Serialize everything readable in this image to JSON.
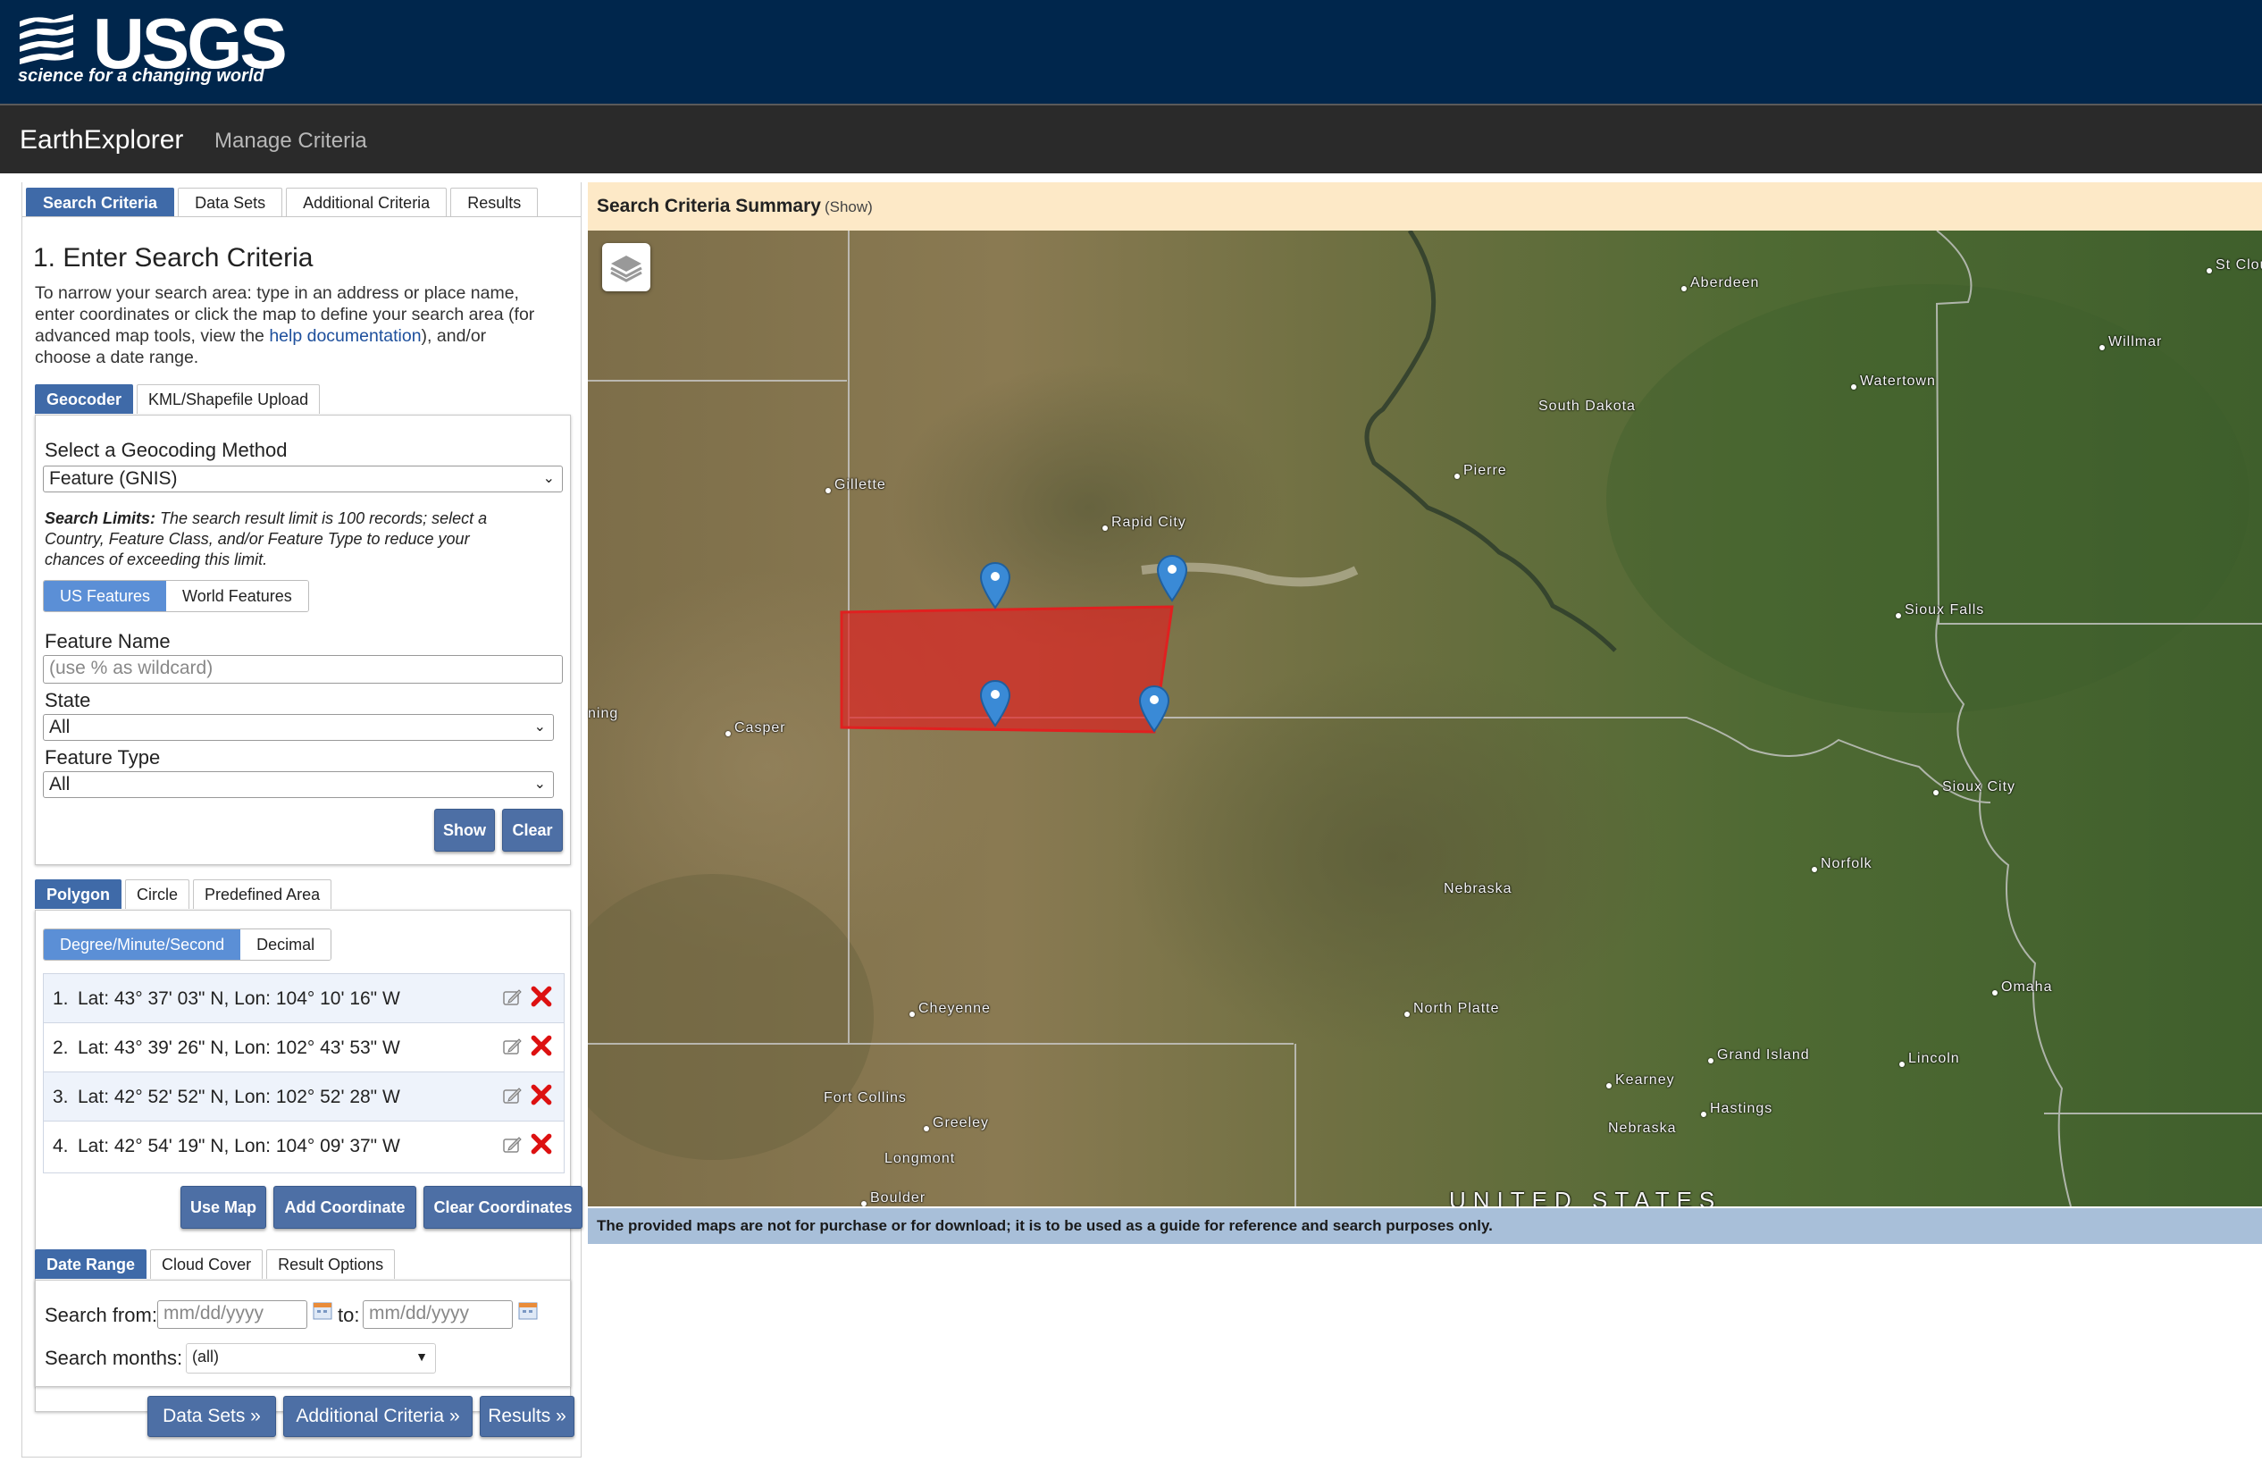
{
  "header": {
    "logo_text": "USGS",
    "tagline": "science for a changing world",
    "app_title": "EarthExplorer",
    "manage_link": "Manage Criteria"
  },
  "main_tabs": [
    "Search Criteria",
    "Data Sets",
    "Additional Criteria",
    "Results"
  ],
  "step": {
    "heading": "1. Enter Search Criteria",
    "intro_1": "To narrow your search area: type in an address or place name,",
    "intro_2": "enter coordinates or click the map to define your search area (for",
    "intro_3a": "advanced map tools, view the ",
    "intro_link": "help documentation",
    "intro_3b": "), and/or",
    "intro_4": "choose a date range."
  },
  "geocoder_tabs": [
    "Geocoder",
    "KML/Shapefile Upload"
  ],
  "geocoder": {
    "method_label": "Select a Geocoding Method",
    "method_value": "Feature (GNIS)",
    "limits_title": "Search Limits:",
    "limits_1": " The search result limit is 100 records; select a",
    "limits_2": "Country, Feature Class, and/or Feature Type to reduce your",
    "limits_3": "chances of exceeding this limit.",
    "feature_toggle": [
      "US Features",
      "World Features"
    ],
    "feature_name_label": "Feature Name",
    "feature_name_placeholder": "(use % as wildcard)",
    "state_label": "State",
    "state_value": "All",
    "feature_type_label": "Feature Type",
    "feature_type_value": "All",
    "show_btn": "Show",
    "clear_btn": "Clear"
  },
  "area_tabs": [
    "Polygon",
    "Circle",
    "Predefined Area"
  ],
  "coord_format": [
    "Degree/Minute/Second",
    "Decimal"
  ],
  "coordinates": [
    {
      "num": "1.",
      "text": "Lat: 43° 37' 03\" N, Lon: 104° 10' 16\" W"
    },
    {
      "num": "2.",
      "text": "Lat: 43° 39' 26\" N, Lon: 102° 43' 53\" W"
    },
    {
      "num": "3.",
      "text": "Lat: 42° 52' 52\" N, Lon: 102° 52' 28\" W"
    },
    {
      "num": "4.",
      "text": "Lat: 42° 54' 19\" N, Lon: 104° 09' 37\" W"
    }
  ],
  "coord_buttons": {
    "use_map": "Use Map",
    "add": "Add Coordinate",
    "clear": "Clear Coordinates"
  },
  "date_tabs": [
    "Date Range",
    "Cloud Cover",
    "Result Options"
  ],
  "date": {
    "from_label": "Search from:",
    "from_placeholder": "mm/dd/yyyy",
    "to_label": "to:",
    "to_placeholder": "mm/dd/yyyy",
    "months_label": "Search months:",
    "months_value": "(all)"
  },
  "nav_buttons": [
    "Data Sets »",
    "Additional Criteria »",
    "Results »"
  ],
  "summary": {
    "title": "Search Criteria Summary",
    "show": "(Show)"
  },
  "map_labels": {
    "aberdeen": "Aberdeen",
    "st_cloud": "St Clou",
    "willmar": "Willmar",
    "watertown": "Watertown",
    "south_dakota": "South Dakota",
    "pierre": "Pierre",
    "gillette": "Gillette",
    "rapid_city": "Rapid City",
    "sioux_falls": "Sioux Falls",
    "wyoming": "ning",
    "casper": "Casper",
    "sioux_city": "Sioux City",
    "norfolk": "Norfolk",
    "nebraska": "Nebraska",
    "omaha": "Omaha",
    "cheyenne": "Cheyenne",
    "north_platte": "North Platte",
    "grand_island": "Grand Island",
    "lincoln": "Lincoln",
    "kearney": "Kearney",
    "hastings": "Hastings",
    "nebraska2": "Nebraska",
    "fort_collins": "Fort Collins",
    "greeley": "Greeley",
    "longmont": "Longmont",
    "boulder": "Boulder",
    "united_states": "UNITED STATES"
  },
  "disclaimer": "The provided maps are not for purchase or for download; it is to be used as a guide for reference and search purposes only.",
  "colors": {
    "header": "#00264c",
    "appbar": "#2a2a2a",
    "accent": "#3f6aa8",
    "polygon": "#e02020"
  }
}
